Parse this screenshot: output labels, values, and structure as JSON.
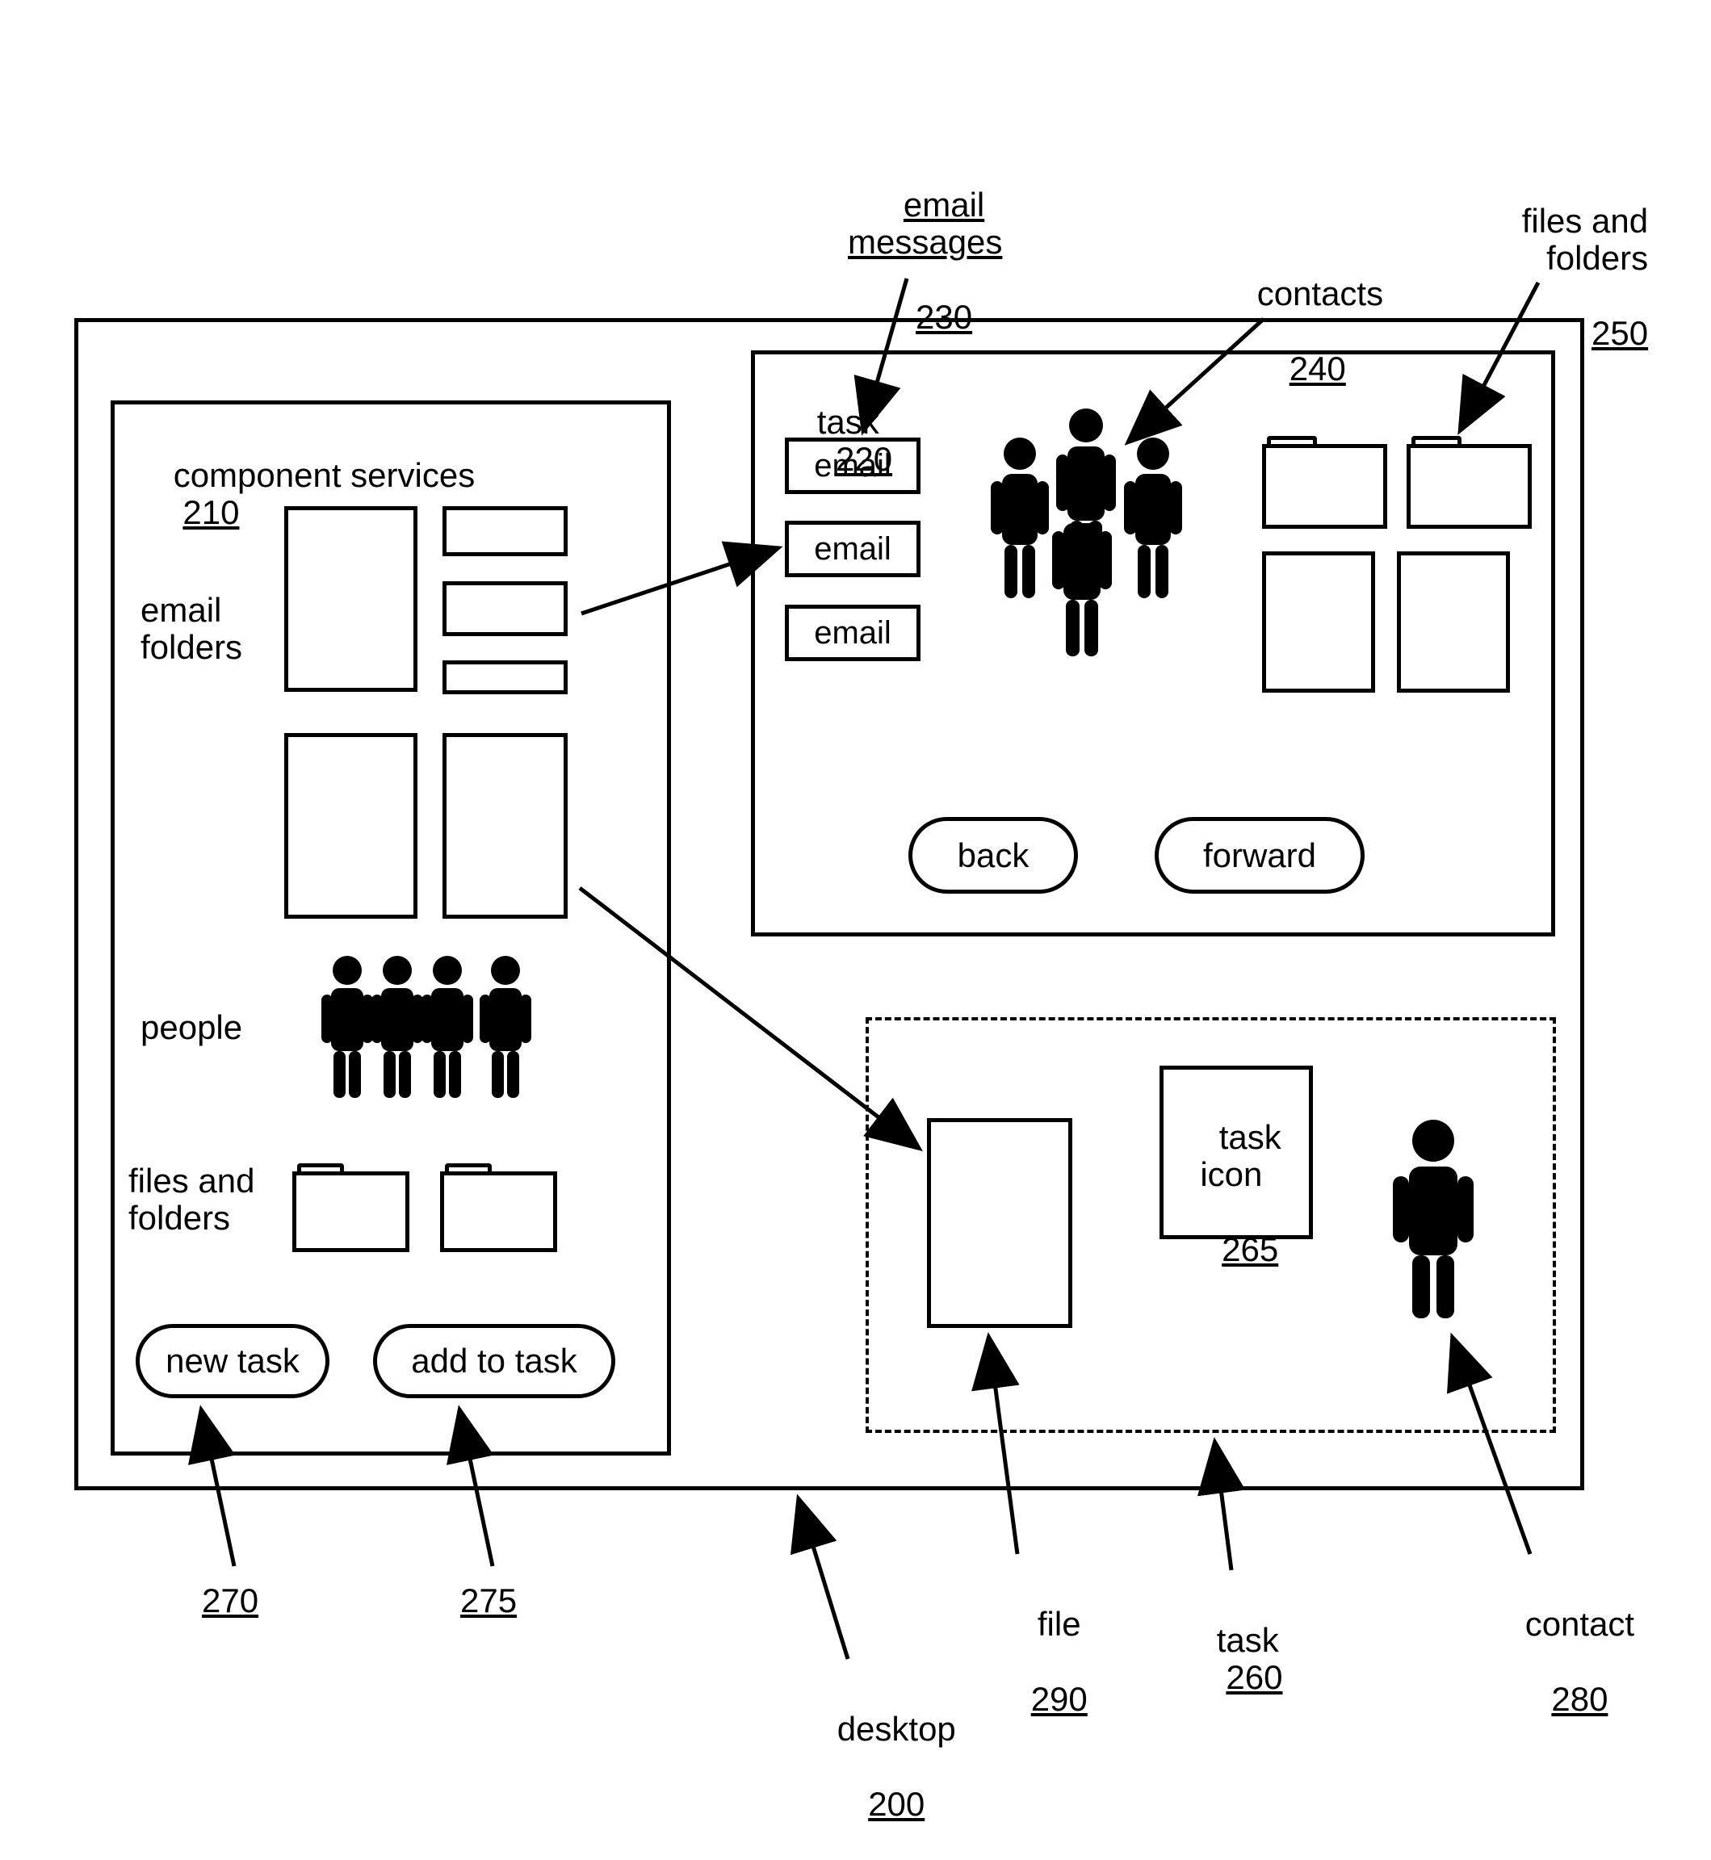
{
  "callouts": {
    "email_messages": {
      "label": "email\nmessages",
      "ref": "230"
    },
    "contacts": {
      "label": "contacts",
      "ref": "240"
    },
    "files_and_folders": {
      "label": "files and\nfolders",
      "ref": "250"
    },
    "new_task_ref": "270",
    "add_to_task_ref": "275",
    "file": {
      "label": "file",
      "ref": "290"
    },
    "task260": {
      "label": "task",
      "ref": "260"
    },
    "contact": {
      "label": "contact",
      "ref": "280"
    },
    "desktop": {
      "label": "desktop",
      "ref": "200"
    }
  },
  "desktop": {
    "component_services": {
      "title": "component services",
      "ref": "210",
      "email_folders_label": "email\nfolders",
      "people_label": "people",
      "files_and_folders_label": "files and\nfolders",
      "new_task_btn": "new task",
      "add_to_task_btn": "add to  task"
    },
    "task_panel": {
      "title": "task",
      "ref": "220",
      "email_items": [
        "email",
        "email",
        "email"
      ],
      "back_btn": "back",
      "forward_btn": "forward"
    },
    "task_area": {
      "task_icon": {
        "label": "task\nicon",
        "ref": "265"
      }
    }
  }
}
